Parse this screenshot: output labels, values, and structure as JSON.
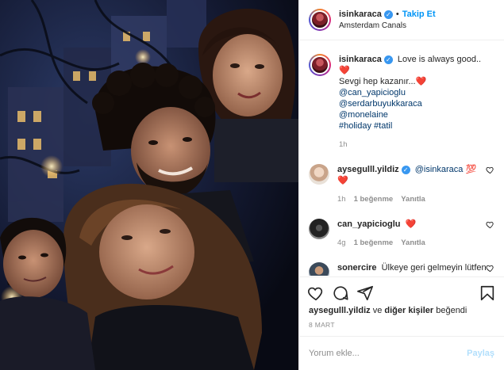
{
  "post": {
    "author": "isinkaraca",
    "follow_label": "Takip Et",
    "separator": "•",
    "location": "Amsterdam Canals"
  },
  "caption": {
    "username": "isinkaraca",
    "line1": "Love is always good..",
    "line2": "Sevgi hep kazanır...",
    "mentions": [
      "@can_yapicioglu",
      "@serdarbuyukkaraca",
      "@monelaine"
    ],
    "tags": [
      "#holiday",
      "#tatil"
    ],
    "time": "1h"
  },
  "comments": [
    {
      "username": "aysegulll.yildiz",
      "text": "@isinkaraca",
      "emoji": "💯",
      "second_line": "❤️",
      "time": "1h",
      "likes": "1 beğenme",
      "reply": "Yanıtla"
    },
    {
      "username": "can_yapicioglu",
      "text": "",
      "emoji": "❤️",
      "time": "4g",
      "likes": "1 beğenme",
      "reply": "Yanıtla"
    },
    {
      "username": "sonercire",
      "text": "Ülkeye geri gelmeyin lütfen"
    }
  ],
  "likes_line": {
    "user": "aysegulll.yildiz",
    "connector": "ve",
    "others": "diğer kişiler",
    "suffix": "beğendi"
  },
  "date": "8 MART",
  "add_comment": {
    "placeholder": "Yorum ekle...",
    "post_label": "Paylaş"
  },
  "colors": {
    "accent": "#0095f6",
    "verified": "#3897f0",
    "heart": "#ed4956",
    "muted": "#8e8e8e"
  },
  "icons": [
    "verified-badge-icon",
    "heart-outline-icon",
    "comment-icon",
    "share-icon",
    "bookmark-icon"
  ]
}
